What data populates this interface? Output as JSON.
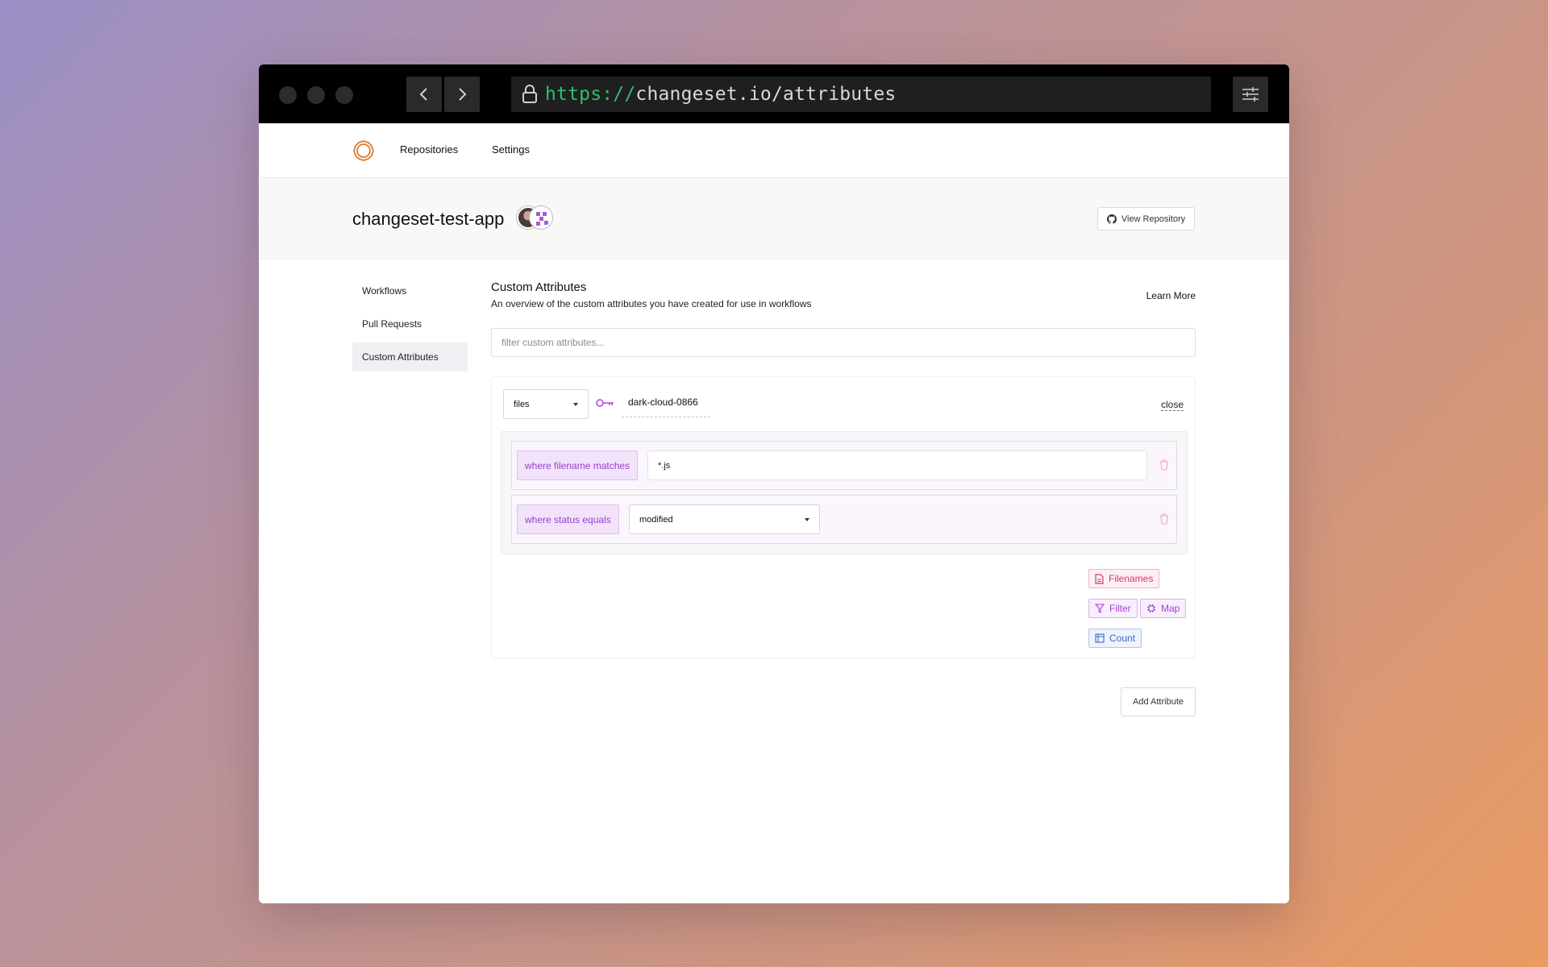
{
  "browser": {
    "url_scheme": "https://",
    "url_rest": "changeset.io/attributes"
  },
  "topnav": {
    "items": [
      {
        "label": "Repositories"
      },
      {
        "label": "Settings"
      }
    ]
  },
  "header": {
    "repo_name": "changeset-test-app",
    "view_repository_label": "View Repository"
  },
  "sidebar": {
    "items": [
      {
        "label": "Workflows",
        "active": false
      },
      {
        "label": "Pull Requests",
        "active": false
      },
      {
        "label": "Custom Attributes",
        "active": true
      }
    ]
  },
  "main": {
    "title": "Custom Attributes",
    "subtitle": "An overview of the custom attributes you have created for use in workflows",
    "learn_more": "Learn More",
    "search_placeholder": "filter custom attributes...",
    "attribute": {
      "source": "files",
      "name": "dark-cloud-0866",
      "close_label": "close",
      "rules": [
        {
          "label": "where filename matches",
          "value": "*.js"
        },
        {
          "label": "where status equals",
          "value": "modified"
        }
      ],
      "operations": {
        "filenames": "Filenames",
        "filter": "Filter",
        "map": "Map",
        "count": "Count"
      }
    },
    "add_attribute_label": "Add Attribute"
  },
  "colors": {
    "accent_purple": "#9b3dcc",
    "accent_pink": "#d7336f",
    "accent_blue": "#3a6bc7",
    "url_scheme_green": "#2fbf71",
    "logo_orange": "#e07b2a"
  }
}
